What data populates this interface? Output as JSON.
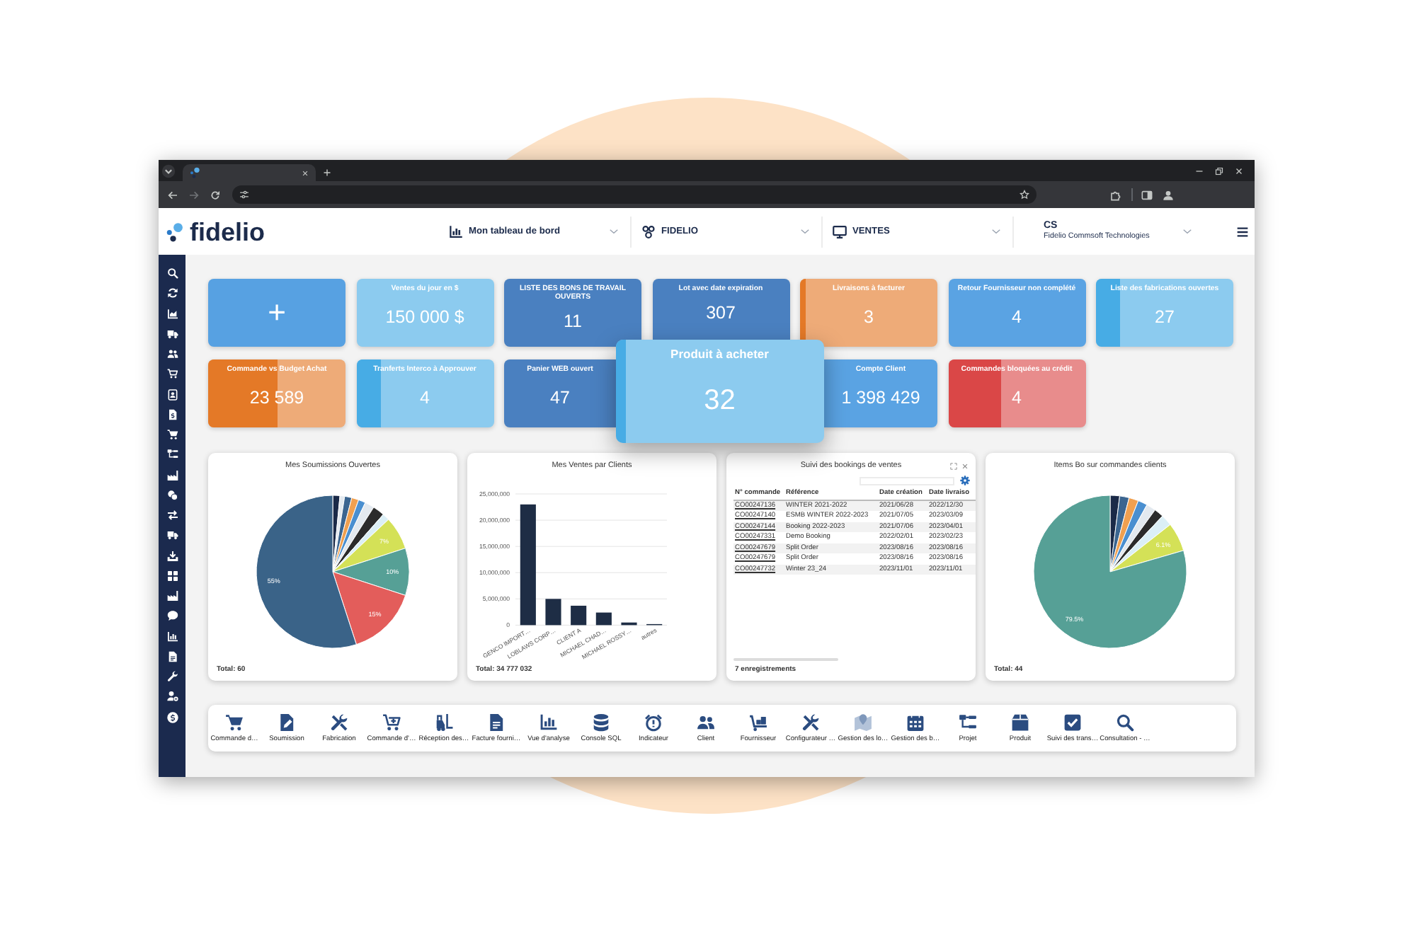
{
  "header": {
    "logo_text": "fidelio",
    "menus": [
      {
        "kind": "dashboard",
        "label": "Mon tableau de bord"
      },
      {
        "kind": "company",
        "label": "FIDELIO"
      },
      {
        "kind": "module",
        "label": "VENTES"
      },
      {
        "kind": "user",
        "label": "CS",
        "sublabel": "Fidelio Commsoft Technologies"
      }
    ]
  },
  "tile_rows": [
    {
      "tiles": [
        {
          "kind": "add",
          "value": "+",
          "color": "#57a1e2"
        },
        {
          "kind": "metric",
          "title": "Ventes du jour en $",
          "value": "150 000 $",
          "color": "#8ccbef"
        },
        {
          "kind": "metric",
          "title": "LISTE DES BONS DE TRAVAIL OUVERTS",
          "value": "11",
          "color": "#4a80c0"
        },
        {
          "kind": "metric",
          "title": "Lot avec date expiration",
          "value": "307",
          "color": "#4a80c0"
        },
        {
          "kind": "metric",
          "title": "Livraisons à facturer",
          "value": "3",
          "color": "#eeab78",
          "level": 0.04
        },
        {
          "kind": "metric",
          "title": "Retour Fournisseur non complété",
          "value": "4",
          "color": "#5aa3e3"
        },
        {
          "kind": "metric",
          "title": "Liste des fabrications ouvertes",
          "value": "27",
          "color": "#8ccbef",
          "level": 0.18
        }
      ]
    },
    {
      "tiles": [
        {
          "kind": "metric",
          "title": "Commande vs Budget Achat",
          "value": "23 589",
          "color": "#eeab78",
          "level": 0.51
        },
        {
          "kind": "metric",
          "title": "Tranferts Interco à Approuver",
          "value": "4",
          "color": "#8ccbef",
          "level": 0.18
        },
        {
          "kind": "metric",
          "title": "Panier WEB ouvert",
          "value": "47",
          "color": "#4a80c0"
        },
        {
          "kind": "metric",
          "title": "Compte Client",
          "value": "1 398 429",
          "color": "#5aa3e3"
        },
        {
          "kind": "metric",
          "title": "Commandes bloquées au crédit",
          "value": "4",
          "color": "#e88c8c",
          "level": 0.39
        }
      ]
    }
  ],
  "dragged_tile": {
    "title": "Produit à acheter",
    "value": "32",
    "color": "#8ccbef",
    "level": 0.05
  },
  "widgets": [
    {
      "kind": "chart",
      "chart_data": {
        "type": "pie",
        "title": "Mes Soumissions Ouvertes",
        "values": [
          1.5,
          1,
          1.5,
          1.5,
          1.5,
          2,
          2.5,
          1.5,
          7,
          10,
          15,
          55
        ],
        "colors": [
          "#1b2a48",
          "#e3e9ef",
          "#3b6590",
          "#f0a050",
          "#4a8fd0",
          "#e3e9ef",
          "#2b2b2b",
          "#dbeff6",
          "#d4e157",
          "#56a096",
          "#e35d5b",
          "#3a6388"
        ],
        "value_labels": [
          null,
          null,
          null,
          null,
          null,
          null,
          null,
          null,
          "7%",
          "10%",
          "15%",
          "55%"
        ]
      },
      "footer": "Total: 60"
    },
    {
      "kind": "chart",
      "chart_data": {
        "type": "bar",
        "title": "Mes Ventes par Clients",
        "categories": [
          "GENCO IMPORT…",
          "LOBLAWS CORP…",
          "CLIENT A",
          "MICHAEL CHAD…",
          "MICHAEL ROSSY…",
          "autres"
        ],
        "values": [
          23000000,
          5000000,
          3700000,
          2400000,
          500000,
          200000
        ],
        "ylim": [
          0,
          25000000
        ],
        "yticks": [
          {
            "value": 0,
            "label": "0"
          },
          {
            "value": 5000000,
            "label": "5,000,000"
          },
          {
            "value": 10000000,
            "label": "10,000,000"
          },
          {
            "value": 15000000,
            "label": "15,000,000"
          },
          {
            "value": 20000000,
            "label": "20,000,000"
          },
          {
            "value": 25000000,
            "label": "25,000,000"
          }
        ],
        "grid": true
      },
      "footer": "Total: 34 777 032"
    },
    {
      "kind": "table",
      "title": "Suivi des bookings de ventes",
      "columns": [
        "N° commande",
        "Référence",
        "Date création",
        "Date livraiso"
      ],
      "rows": [
        [
          "CO00247136",
          "WINTER 2021-2022",
          "2021/06/28",
          "2022/12/30"
        ],
        [
          "CO00247140",
          "ESMB WINTER 2022-2023",
          "2021/07/05",
          "2023/03/09"
        ],
        [
          "CO00247144",
          "Booking 2022-2023",
          "2021/07/06",
          "2023/04/01"
        ],
        [
          "CO00247331",
          "Demo Booking",
          "2022/02/01",
          "2023/02/23"
        ],
        [
          "CO00247679",
          "Split Order",
          "2023/08/16",
          "2023/08/16"
        ],
        [
          "CO00247679",
          "Split Order",
          "2023/08/16",
          "2023/08/16"
        ],
        [
          "CO00247732",
          "Winter 23_24",
          "2023/11/01",
          "2023/11/01"
        ]
      ],
      "footer": "7 enregistrements"
    },
    {
      "kind": "chart",
      "chart_data": {
        "type": "pie",
        "title": "Items Bo sur commandes clients",
        "values": [
          2,
          2,
          2,
          2,
          2,
          2,
          2.4,
          6.1,
          79.5
        ],
        "colors": [
          "#1b2a48",
          "#3b6590",
          "#f0a050",
          "#4a8fd0",
          "#e3e9ef",
          "#2b2b2b",
          "#dbeff6",
          "#d4e157",
          "#56a096"
        ],
        "value_labels": [
          null,
          null,
          null,
          null,
          null,
          null,
          null,
          "6.1%",
          "79.5%"
        ]
      },
      "footer": "Total: 44"
    }
  ],
  "shortcuts": [
    {
      "label": "Commande d…"
    },
    {
      "label": "Soumission"
    },
    {
      "label": "Fabrication"
    },
    {
      "label": "Commande d'…"
    },
    {
      "label": "Réception des…"
    },
    {
      "label": "Facture fourni…"
    },
    {
      "label": "Vue d'analyse"
    },
    {
      "label": "Console SQL"
    },
    {
      "label": "Indicateur"
    },
    {
      "label": "Client"
    },
    {
      "label": "Fournisseur"
    },
    {
      "label": "Configurateur …"
    },
    {
      "label": "Gestion des lo…"
    },
    {
      "label": "Gestion des b…"
    },
    {
      "label": "Projet"
    },
    {
      "label": "Produit"
    },
    {
      "label": "Suivi des trans…"
    },
    {
      "label": "Consultation - …"
    }
  ]
}
